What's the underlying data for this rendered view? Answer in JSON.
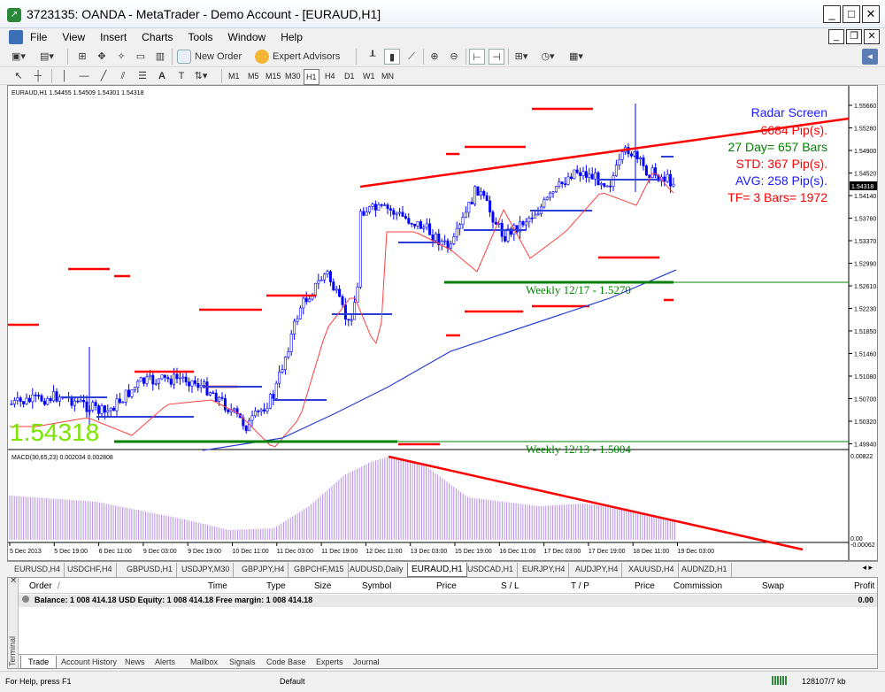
{
  "window": {
    "title": "3723135: OANDA - MetaTrader - Demo Account - [EURAUD,H1]"
  },
  "menu": [
    "File",
    "View",
    "Insert",
    "Charts",
    "Tools",
    "Window",
    "Help"
  ],
  "toolbar": {
    "new_order": "New Order",
    "expert_advisors": "Expert Advisors"
  },
  "timeframes": [
    "M1",
    "M5",
    "M15",
    "M30",
    "H1",
    "H4",
    "D1",
    "W1",
    "MN"
  ],
  "timeframe_selected": "H1",
  "chart": {
    "header": "EURAUD,H1  1.54455 1.54509 1.54301 1.54318",
    "big_price": "1.54318",
    "current_price": "1.54318",
    "colors": {
      "candle": "#0000ff",
      "resistance": "#ff0000",
      "ma_fast": "#ff4040",
      "ma_slow": "#2b3fd6",
      "weekly": "#008000",
      "big_price": "#7ae600",
      "macd": "#b58de8"
    },
    "price_axis": [
      "1.55660",
      "1.55280",
      "1.54900",
      "1.54520",
      "1.54140",
      "1.53760",
      "1.53370",
      "1.52990",
      "1.52610",
      "1.52230",
      "1.51850",
      "1.51460",
      "1.51080",
      "1.50700",
      "1.50320",
      "1.49940"
    ],
    "time_axis": [
      "5 Dec 2013",
      "5 Dec 19:00",
      "6 Dec 11:00",
      "9 Dec 03:00",
      "9 Dec 19:00",
      "10 Dec 11:00",
      "11 Dec 03:00",
      "11 Dec 19:00",
      "12 Dec 11:00",
      "13 Dec 03:00",
      "15 Dec 19:00",
      "16 Dec 11:00",
      "17 Dec 03:00",
      "17 Dec 19:00",
      "18 Dec 11:00",
      "19 Dec 03:00"
    ],
    "radar": {
      "title": "Radar Screen",
      "pips": "6684 Pip(s).",
      "day": "27 Day= 657 Bars",
      "std": "STD: 367 Pip(s).",
      "avg": "AVG: 258 Pip(s).",
      "tf": "TF= 3 Bars= 1972"
    },
    "weekly_1": "Weekly 12/17 - 1.5270",
    "weekly_2": "Weekly 12/13 - 1.5004",
    "macd": {
      "header": "MACD(30,65,23) 0.002034 0.002808",
      "axis_top": "0.00822",
      "axis_bottom": "0.00",
      "axis_bottom2": "-0.00062"
    }
  },
  "chart_tabs": [
    "EURUSD,H4",
    "USDCHF,H4",
    "GBPUSD,H1",
    "USDJPY,M30",
    "GBPJPY,H4",
    "GBPCHF,M15",
    "AUDUSD,Daily",
    "EURAUD,H1",
    "USDCAD,H1",
    "EURJPY,H4",
    "AUDJPY,H4",
    "XAUUSD,H4",
    "AUDNZD,H1"
  ],
  "chart_tab_active": "EURAUD,H1",
  "terminal": {
    "side_label": "Terminal",
    "columns": [
      "Order",
      "Time",
      "Type",
      "Size",
      "Symbol",
      "Price",
      "S / L",
      "T / P",
      "Price",
      "Commission",
      "Swap",
      "Profit"
    ],
    "balance_line": "Balance: 1 008 414.18 USD  Equity: 1 008 414.18  Free margin: 1 008 414.18",
    "balance_profit": "0.00",
    "tabs": [
      "Trade",
      "Account History",
      "News",
      "Alerts",
      "Mailbox",
      "Signals",
      "Code Base",
      "Experts",
      "Journal"
    ]
  },
  "status": {
    "help": "For Help, press F1",
    "profile": "Default",
    "traffic": "128107/7 kb"
  }
}
